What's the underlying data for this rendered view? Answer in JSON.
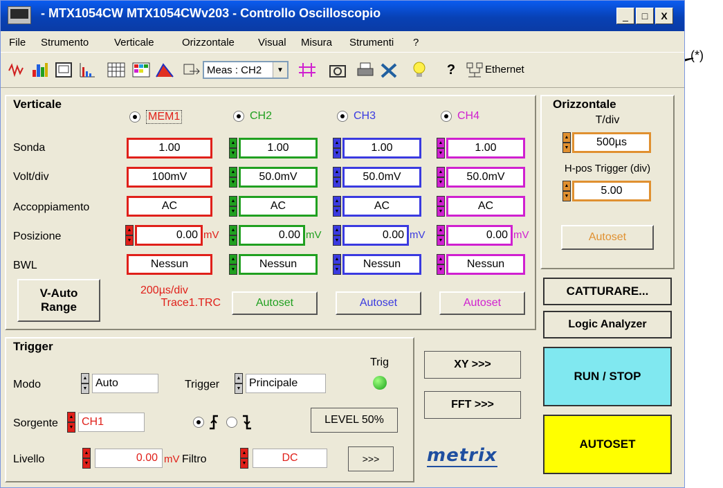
{
  "window": {
    "title": "- MTX1054CW MTX1054CWv203 - Controllo Oscilloscopio",
    "controls": {
      "minimize": "_",
      "maximize": "□",
      "close": "X"
    }
  },
  "menu": [
    "File",
    "Strumento",
    "Verticale",
    "Orizzontale",
    "Visual",
    "Misura",
    "Strumenti",
    "?"
  ],
  "toolbar": {
    "meas_select": "Meas : CH2",
    "ethernet_label": "Ethernet",
    "icons": [
      "waveform-icon",
      "color-spectrum-icon",
      "display-icon",
      "histogram-icon",
      "grid-icon",
      "persistence-icon",
      "envelope-icon",
      "fit-icon",
      "cursor-icon",
      "camera-icon",
      "printer-icon",
      "tools-icon",
      "lightbulb-icon",
      "help-icon",
      "network-icon"
    ]
  },
  "annotation": "(*)",
  "verticale": {
    "title": "Verticale",
    "row_labels": {
      "sonda": "Sonda",
      "volt": "Volt/div",
      "acc": "Accoppiamento",
      "pos": "Posizione",
      "bwl": "BWL"
    },
    "unit": "mV",
    "channels": [
      {
        "name": "MEM1",
        "color": "#e0201a",
        "sonda": "1.00",
        "volt": "100mV",
        "acc": "AC",
        "pos": "0.00",
        "bwl": "Nessun"
      },
      {
        "name": "CH2",
        "color": "#20a020",
        "sonda": "1.00",
        "volt": "50.0mV",
        "acc": "AC",
        "pos": "0.00",
        "bwl": "Nessun"
      },
      {
        "name": "CH3",
        "color": "#3a3ae0",
        "sonda": "1.00",
        "volt": "50.0mV",
        "acc": "AC",
        "pos": "0.00",
        "bwl": "Nessun"
      },
      {
        "name": "CH4",
        "color": "#d020d0",
        "sonda": "1.00",
        "volt": "50.0mV",
        "acc": "AC",
        "pos": "0.00",
        "bwl": "Nessun"
      }
    ],
    "vauto": [
      "V-Auto",
      "Range"
    ],
    "mem_info": [
      "200µs/div",
      "Trace1.TRC"
    ],
    "autoset": "Autoset"
  },
  "orizzontale": {
    "title": "Orizzontale",
    "tdiv_label": "T/div",
    "tdiv": "500µs",
    "hpos_label": "H-pos Trigger (div)",
    "hpos": "5.00",
    "autoset": "Autoset",
    "color": "#e09030"
  },
  "buttons": {
    "catturare": "CATTURARE...",
    "logic": "Logic Analyzer",
    "run": "RUN / STOP",
    "autoset": "AUTOSET",
    "xy": "XY >>>",
    "fft": "FFT >>>",
    "level": "LEVEL 50%",
    "more": ">>>"
  },
  "trigger": {
    "title": "Trigger",
    "modo_label": "Modo",
    "modo": "Auto",
    "trigger_label": "Trigger",
    "trigger": "Principale",
    "trig_label": "Trig",
    "sorgente_label": "Sorgente",
    "sorgente": "CH1",
    "livello_label": "Livello",
    "livello": "0.00",
    "livello_unit": "mV",
    "filtro_label": "Filtro",
    "filtro": "DC"
  },
  "logo": "metrix"
}
